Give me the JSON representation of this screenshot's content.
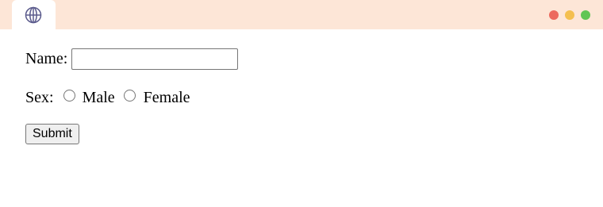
{
  "browser": {
    "tab_icon": "globe-icon",
    "controls": [
      {
        "name": "close",
        "color": "#ec6a5e"
      },
      {
        "name": "minimize",
        "color": "#f4bf4f"
      },
      {
        "name": "maximize",
        "color": "#61c554"
      }
    ],
    "titlebar_color": "#fde6d7"
  },
  "form": {
    "name_label": "Name:",
    "name_value": "",
    "sex_label": "Sex:",
    "options": [
      {
        "label": "Male",
        "checked": false
      },
      {
        "label": "Female",
        "checked": false
      }
    ],
    "submit_label": "Submit"
  }
}
